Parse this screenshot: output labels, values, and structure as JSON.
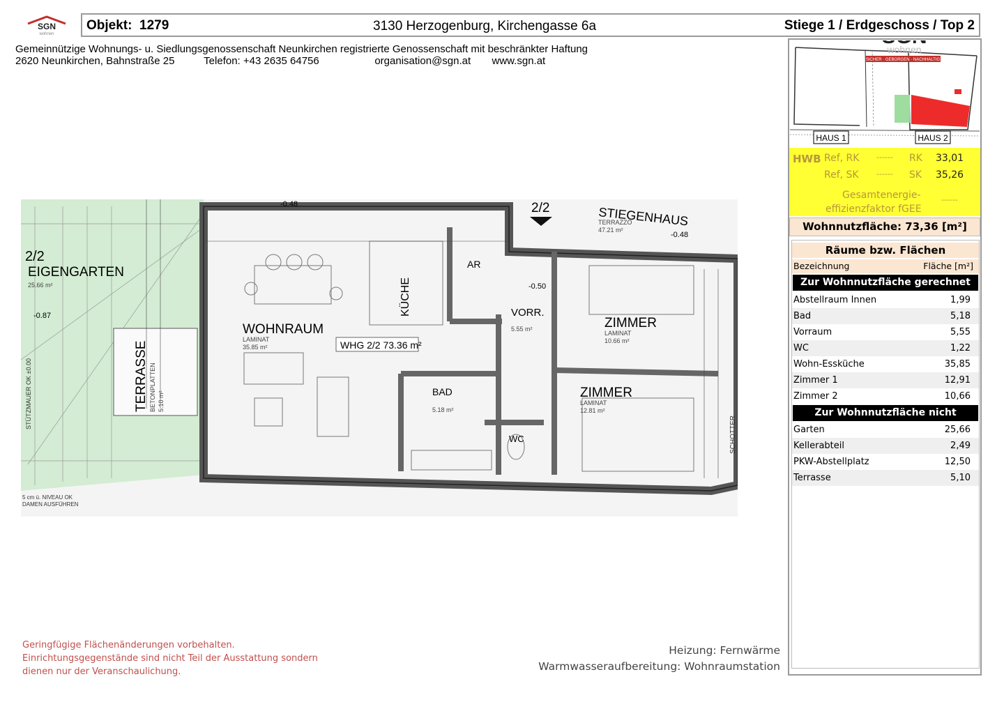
{
  "header": {
    "logo_text": "SGN",
    "logo_subtext": "wohnen",
    "objekt_label": "Objekt:",
    "objekt_nr": "1279",
    "address": "3130 Herzogenburg, Kirchengasse 6a",
    "stiege": "Stiege 1 / Erdgeschoss / Top 2"
  },
  "company": {
    "name": "Gemeinnützige Wohnungs- u. Siedlungsgenossenschaft Neunkirchen registrierte Genossenschaft mit beschränkter Haftung",
    "street": "2620 Neunkirchen, Bahnstraße 25",
    "phone": "Telefon: +43 2635  64756",
    "email": "organisation@sgn.at",
    "web": "www.sgn.at"
  },
  "siteplan": {
    "logo_text": "SGN",
    "logo_sub": "wohnen",
    "slogan": "SICHER · GEBORGEN · NACHHALTIG",
    "haus1": "HAUS 1",
    "haus2": "HAUS 2"
  },
  "energy": {
    "hwb": "HWB",
    "ref_rk": "Ref, RK",
    "ref_sk": "Ref, SK",
    "dash": "------",
    "rk": "RK",
    "sk": "SK",
    "rk_value": "33,01",
    "sk_value": "35,26",
    "fgee_line1": "Gesamtenergie-",
    "fgee_line2": "effizienzfaktor fGEE",
    "fgee_value": "------"
  },
  "summary": {
    "wohnnutzflaeche": "Wohnnutzfläche: 73,36 [m²]"
  },
  "rooms": {
    "title": "Räume bzw. Flächen",
    "col_name": "Bezeichnung",
    "col_area": "Fläche [m²]",
    "section_included": "Zur Wohnnutzfläche gerechnet",
    "included": [
      {
        "name": "Abstellraum Innen",
        "area": "1,99"
      },
      {
        "name": "Bad",
        "area": "5,18"
      },
      {
        "name": "Vorraum",
        "area": "5,55"
      },
      {
        "name": "WC",
        "area": "1,22"
      },
      {
        "name": "Wohn-Essküche",
        "area": "35,85"
      },
      {
        "name": "Zimmer 1",
        "area": "12,91"
      },
      {
        "name": "Zimmer 2",
        "area": "10,66"
      }
    ],
    "section_excluded": "Zur Wohnnutzfläche nicht gerechnet",
    "excluded": [
      {
        "name": "Garten",
        "area": "25,66"
      },
      {
        "name": "Kellerabteil",
        "area": "2,49"
      },
      {
        "name": "PKW-Abstellplatz",
        "area": "12,50"
      },
      {
        "name": "Terrasse",
        "area": "5,10"
      }
    ]
  },
  "plan": {
    "eigengarten_nr": "2/2",
    "eigengarten": "EIGENGARTEN",
    "eigengarten_area": "25.66 m²",
    "terrasse": "TERRASSE",
    "terrasse_sub": "BETONPLATTEN",
    "terrasse_area": "5.10 m²",
    "wohnraum": "WOHNRAUM",
    "wohnraum_floor": "LAMINAT",
    "wohnraum_area": "35.85 m²",
    "whg_label": "WHG 2/2 73.36 m²",
    "kueche": "KÜCHE",
    "ar": "AR",
    "vorr": "VORR.",
    "vorr_area": "5.55 m²",
    "bad": "BAD",
    "bad_area": "5.18 m²",
    "wc": "WC",
    "zimmer": "ZIMMER",
    "zimmer_floor": "LAMINAT",
    "zimmer1_area": "10.66 m²",
    "zimmer2_area": "12.81 m²",
    "top_nr": "2/2",
    "stiegenhaus": "STIEGENHAUS",
    "stiegenhaus_floor": "TERRAZZO",
    "stiegenhaus_area": "47.21 m²",
    "level_1": "-0.48",
    "level_2": "-0.48",
    "level_3": "-0.50",
    "level_4": "-0.87",
    "stuetzmauer": "STÜTZMAUER OK ±0.00",
    "schotter": "SCHOTTER",
    "niveau_1": "5 cm ü. NIVEAU OK",
    "niveau_2": "DAMEN AUSFÜHREN"
  },
  "footer": {
    "note_1": "Geringfügige Flächenänderungen vorbehalten.",
    "note_2": "Einrichtungsgegenstände sind nicht Teil der Ausstattung sondern",
    "note_3": "dienen nur der Veranschaulichung.",
    "heating": "Heizung: Fernwärme",
    "hot_water": "Warmwasseraufbereitung: Wohnraumstation"
  }
}
